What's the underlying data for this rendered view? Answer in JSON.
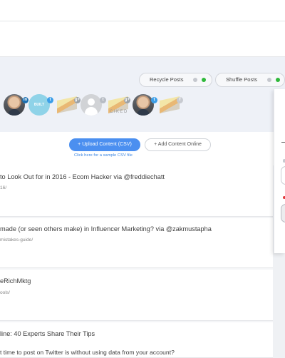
{
  "queue": {
    "recycle_label": "Recycle Posts",
    "shuffle_label": "Shuffle Posts",
    "status_on_color": "#2fb83a",
    "status_off_color": "#c5c8ce",
    "brand_badge_text": "CIKED",
    "teal_avatar_text": "BUILT"
  },
  "actions": {
    "upload_label": "+ Upload Content (CSV)",
    "add_online_label": "+ Add Content Online",
    "sample_csv_link": "Click here for a sample CSV file"
  },
  "posts": [
    {
      "title": "to Look Out for in 2016 - Ecom Hacker via @freddiechatt",
      "url": "16/"
    },
    {
      "title": " made (or seen others make) in Influencer Marketing? via @zakmustapha",
      "url": "mistakes-guide/"
    },
    {
      "title": "eRichMktg",
      "url": "ools/"
    },
    {
      "title": "line: 40 Experts Share Their Tips",
      "url": "t time to post on Twitter is without using data from your account?"
    }
  ],
  "icons": {
    "linkedin": "in",
    "twitter": "t",
    "googleplus": "g+",
    "facebook": "f"
  }
}
